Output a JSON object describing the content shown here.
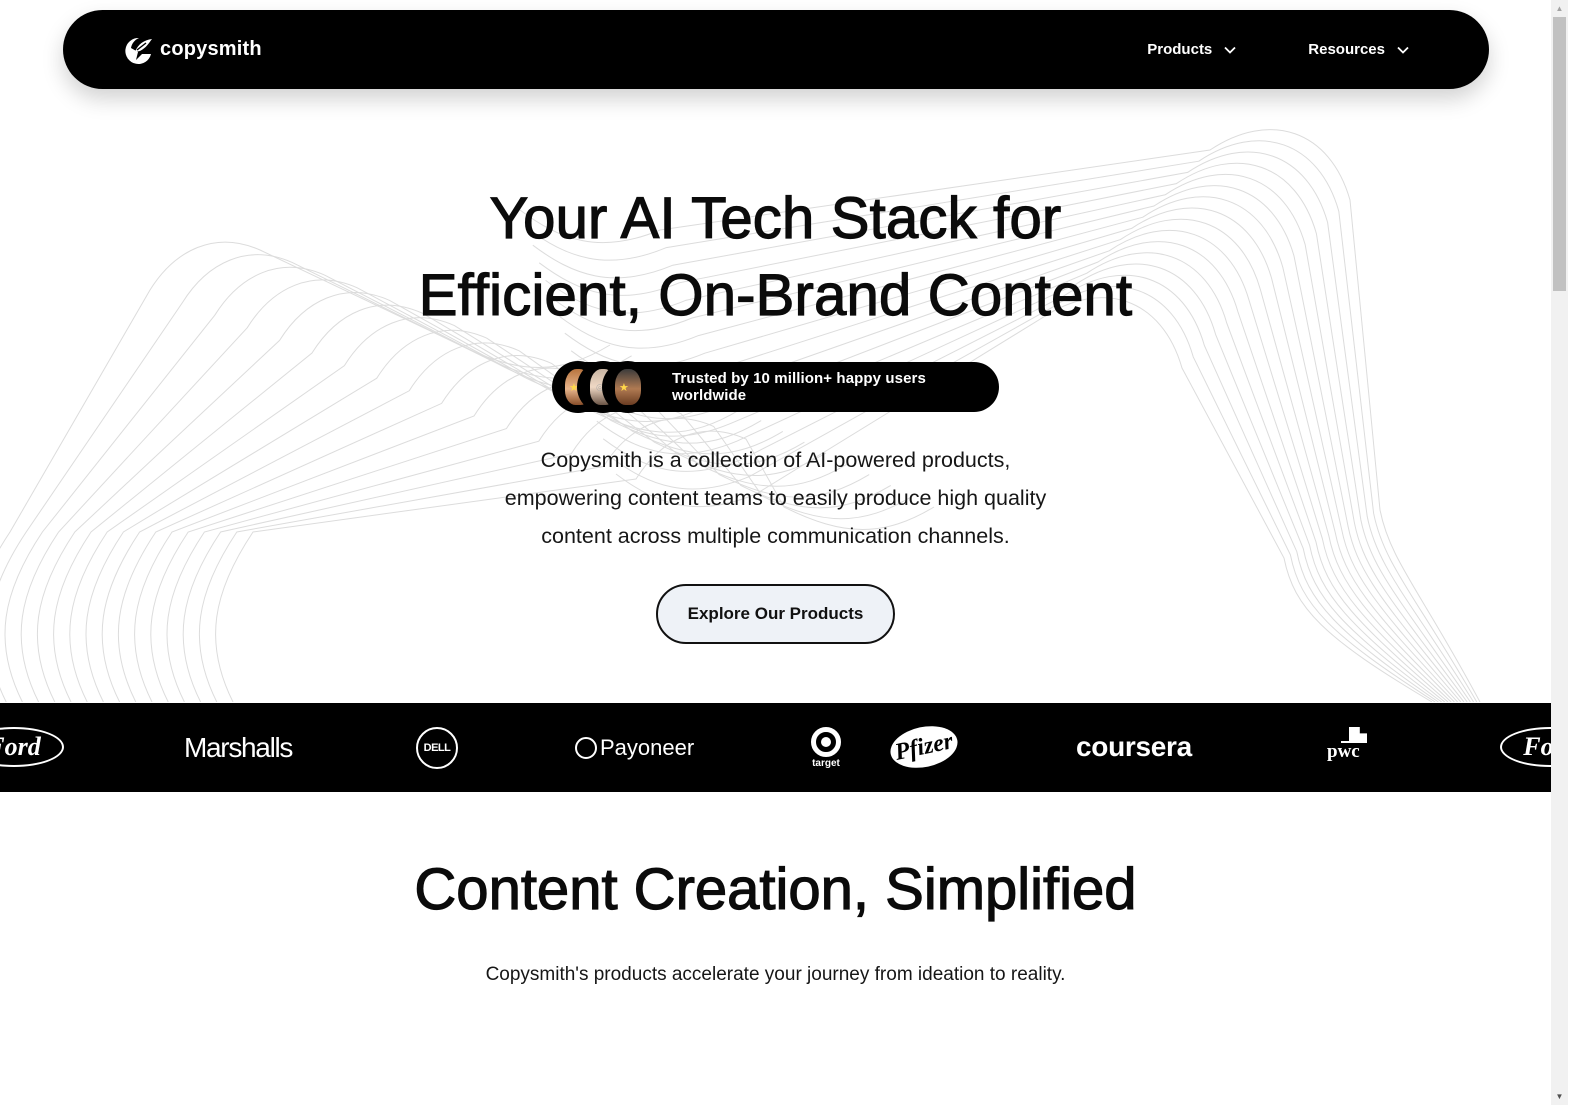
{
  "navbar": {
    "brand_name": "copysmith",
    "logo_icon": "copysmith-quill-logo-icon",
    "menu": [
      {
        "label": "Products",
        "icon": "chevron-down-icon"
      },
      {
        "label": "Resources",
        "icon": "chevron-down-icon"
      }
    ]
  },
  "hero": {
    "title_line1": "Your AI Tech Stack for",
    "title_line2": "Efficient, On-Brand Content",
    "trust_badge": {
      "text": "Trusted by 10 million+ happy users worldwide",
      "avatars": [
        "memoji-avatar-woman",
        "memoji-avatar-man-glasses",
        "memoji-avatar-woman-dark-hair"
      ]
    },
    "description_line1": "Copysmith is a collection of AI-powered products,",
    "description_line2": "empowering content teams to easily produce high quality",
    "description_line3": "content across multiple communication channels.",
    "cta_label": "Explore Our Products"
  },
  "logo_strip": {
    "brands": [
      {
        "name": "Ford",
        "text": "Ford"
      },
      {
        "name": "Marshalls",
        "text": "Marshalls"
      },
      {
        "name": "Dell",
        "text": "DELL"
      },
      {
        "name": "Payoneer",
        "text": "Payoneer"
      },
      {
        "name": "Target",
        "text": "target"
      },
      {
        "name": "Pfizer",
        "text": "Pfizer"
      },
      {
        "name": "Coursera",
        "text": "coursera"
      },
      {
        "name": "PwC",
        "text": "pwc"
      },
      {
        "name": "Ford",
        "text": "Ford"
      }
    ]
  },
  "section": {
    "title": "Content Creation, Simplified",
    "subtitle": "Copysmith's products accelerate your journey from ideation to reality."
  },
  "colors": {
    "nav_bg": "#000000",
    "cta_bg": "#eef2f7",
    "text": "#0b0b0b",
    "wave_stroke": "#dcdcdc"
  },
  "scrollbar": {
    "position_fraction": 0.0
  }
}
